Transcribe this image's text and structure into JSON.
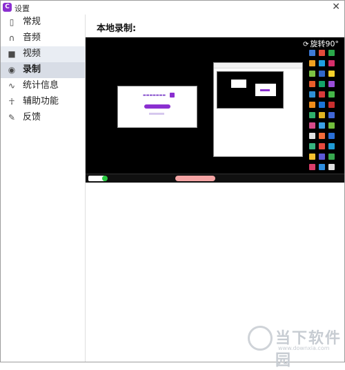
{
  "window": {
    "title": "设置",
    "close_glyph": "✕"
  },
  "sidebar": {
    "items": [
      {
        "label": "常规",
        "icon": "phone-icon"
      },
      {
        "label": "音频",
        "icon": "headphones-icon"
      },
      {
        "label": "视频",
        "icon": "camera-icon"
      },
      {
        "label": "录制",
        "icon": "record-icon"
      },
      {
        "label": "统计信息",
        "icon": "stats-icon"
      },
      {
        "label": "辅助功能",
        "icon": "accessibility-icon"
      },
      {
        "label": "反馈",
        "icon": "feedback-icon"
      }
    ],
    "selected_index": 3
  },
  "main": {
    "section_title": "本地录制:",
    "rotate_button": "旋转90°"
  },
  "watermark": {
    "main": "当下软件园",
    "sub": "www.downxia.com"
  },
  "colors": {
    "accent": "#8b2fd0",
    "active_bg": "#d8dde6",
    "hover_bg": "#e9edf3"
  }
}
